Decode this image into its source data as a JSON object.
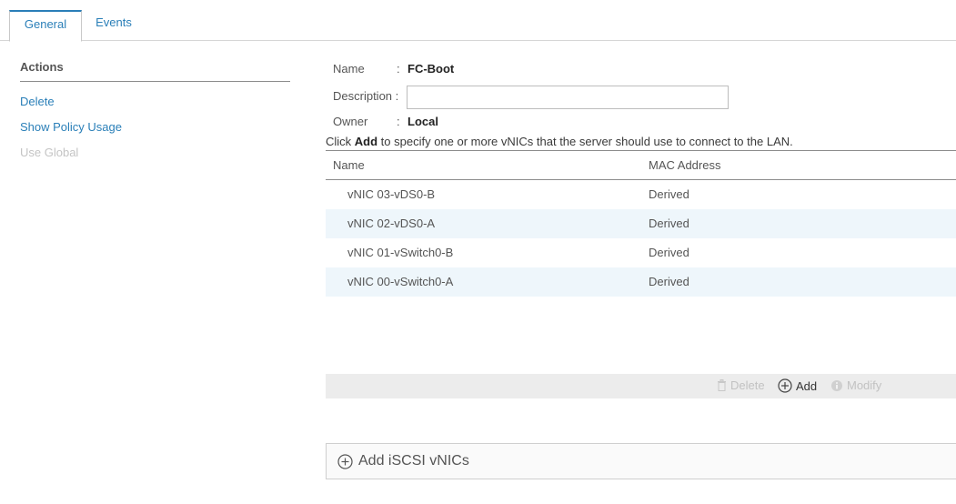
{
  "tabs": [
    {
      "label": "General",
      "active": true
    },
    {
      "label": "Events",
      "active": false
    }
  ],
  "actions": {
    "title": "Actions",
    "items": [
      {
        "label": "Delete",
        "enabled": true
      },
      {
        "label": "Show Policy Usage",
        "enabled": true
      },
      {
        "label": "Use Global",
        "enabled": false
      }
    ]
  },
  "form": {
    "name_label": "Name",
    "name_value": "FC-Boot",
    "description_label": "Description :",
    "description_value": "",
    "owner_label": "Owner",
    "owner_value": "Local",
    "colon": ":"
  },
  "instruction": {
    "prefix": "Click ",
    "bold": "Add",
    "suffix": " to specify one or more vNICs that the server should use to connect to the LAN."
  },
  "table": {
    "columns": [
      "Name",
      "MAC Address"
    ],
    "rows": [
      {
        "name": "vNIC 03-vDS0-B",
        "mac": "Derived"
      },
      {
        "name": "vNIC 02-vDS0-A",
        "mac": "Derived"
      },
      {
        "name": "vNIC 01-vSwitch0-B",
        "mac": "Derived"
      },
      {
        "name": "vNIC 00-vSwitch0-A",
        "mac": "Derived"
      }
    ]
  },
  "toolbar": {
    "delete_label": "Delete",
    "add_label": "Add",
    "modify_label": "Modify"
  },
  "iscsi": {
    "label": "Add iSCSI vNICs"
  },
  "colors": {
    "accent": "#2a7fb8",
    "row_alt": "#eef6fb",
    "toolbar_bg": "#ececec"
  }
}
